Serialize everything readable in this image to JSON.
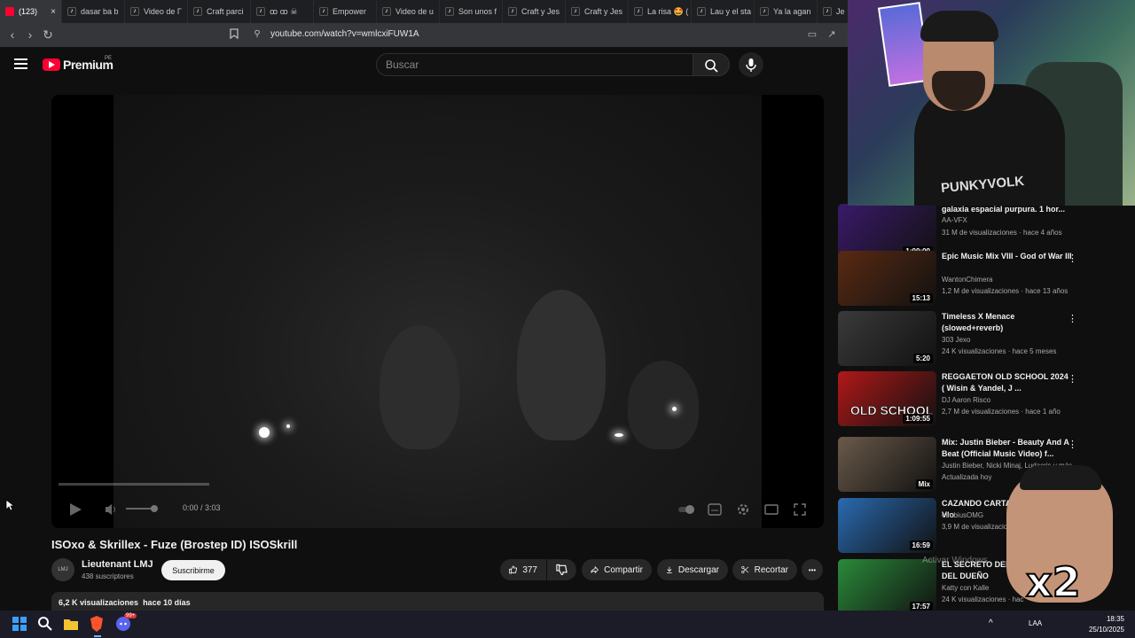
{
  "browser": {
    "tabs": [
      {
        "label": "(123)",
        "active": true
      },
      {
        "label": "dasar ba b"
      },
      {
        "label": "Video de Γ"
      },
      {
        "label": "Craft parci"
      },
      {
        "label": "ꝏ ꝏ ☠"
      },
      {
        "label": "Empower"
      },
      {
        "label": "Video de u"
      },
      {
        "label": "Son unos f"
      },
      {
        "label": "Craft y Jes"
      },
      {
        "label": "Craft y Jes"
      },
      {
        "label": "La risa 🤩 ("
      },
      {
        "label": "Lau y el sta"
      },
      {
        "label": "Ya la agan"
      },
      {
        "label": "Je"
      }
    ],
    "url": "youtube.com/watch?v=wmlcxiFUW1A"
  },
  "header": {
    "logo_text": "Premium",
    "country_code": "PE",
    "search_placeholder": "Buscar"
  },
  "player": {
    "time": "0:00 / 3:03",
    "progress": 0.0
  },
  "video": {
    "title": "ISOxo & Skrillex - Fuze (Brostep ID) ISOSkrill",
    "channel": "Lieutenant LMJ",
    "channel_avatar_text": "LMJ",
    "subscribers": "438 suscriptores",
    "subscribe_label": "Suscribirme",
    "likes": "377",
    "share_label": "Compartir",
    "download_label": "Descargar",
    "clip_label": "Recortar",
    "more_label": "•••",
    "views": "6,2 K visualizaciones",
    "date": "hace 10 días"
  },
  "sidebar": {
    "items": [
      {
        "title": "galaxia espacial purpura. 1 hor...",
        "channel": "AA-VFX",
        "meta": "31 M de visualizaciones · hace 4 años",
        "duration": "1:00:00",
        "color": "#3a1a6a"
      },
      {
        "title": "Epic Music Mix VIII - God of War III",
        "channel": "WantonChimera",
        "meta": "1,2 M de visualizaciones · hace 13 años",
        "duration": "15:13",
        "color": "#5a2a12"
      },
      {
        "title": "Timeless X Menace (slowed+reverb)",
        "channel": "303 Jexo",
        "meta": "24 K visualizaciones · hace 5 meses",
        "duration": "5:20",
        "color": "#3a3a3a"
      },
      {
        "title": "REGGAETON OLD SCHOOL 2024 ( Wisin & Yandel, J ...",
        "channel": "DJ Aaron Risco",
        "meta": "2,7 M de visualizaciones · hace 1 año",
        "duration": "1:09:55",
        "color": "#b01818",
        "thumb_text": "OLD SCHOOL"
      },
      {
        "title": "Mix: Justin Bieber - Beauty And A Beat (Official Music Video) f...",
        "channel": "Justin Bieber, Nicki Minaj, Ludacris y más",
        "meta": "Actualizada hoy",
        "duration": "Mix",
        "color": "#6a5a4a"
      },
      {
        "title": "CAZANDO CARTA JAPON | Epic Vlo",
        "channel": "elrubiusOMG",
        "meta": "3,9 M de visualizacion",
        "duration": "16:59",
        "color": "#2a6ab0"
      },
      {
        "title": "EL SECRETO DEL SA LA MEDIA DEL DUEÑO",
        "channel": "Katty con Kalle",
        "meta": "24 K visualizaciones · hac",
        "duration": "17:57",
        "color": "#2a8a3a"
      }
    ]
  },
  "overlay": {
    "shirt_text": "PUNKYVOLK",
    "multiplier": "x2",
    "watermark": "Activar Windows"
  },
  "taskbar": {
    "time": "18:35",
    "date": "25/10/2025",
    "lang": "LAA",
    "badge": "99+"
  }
}
